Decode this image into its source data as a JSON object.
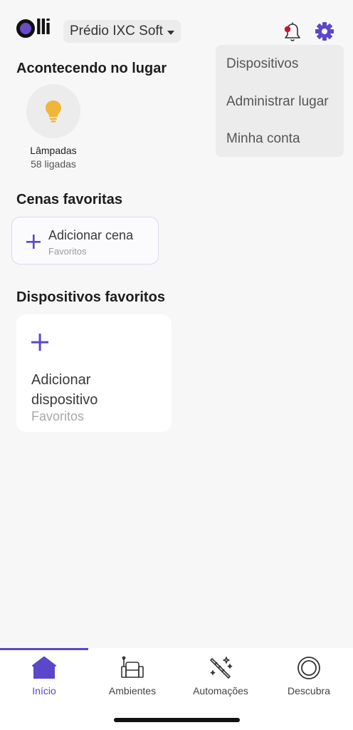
{
  "header": {
    "place_name": "Prédio IXC Soft",
    "brand_color": "#5b47c9",
    "notification_dot_color": "#c5142e"
  },
  "menu": {
    "items": [
      {
        "label": "Dispositivos"
      },
      {
        "label": "Administrar lugar"
      },
      {
        "label": "Minha conta"
      }
    ]
  },
  "happening": {
    "title": "Acontecendo no lugar",
    "lamps": {
      "label": "Lâmpadas",
      "status": "58 ligadas",
      "icon": "lightbulb-icon",
      "icon_color": "#f0b63a"
    }
  },
  "scenes": {
    "title": "Cenas favoritas",
    "add_label": "Adicionar cena",
    "add_sub": "Favoritos"
  },
  "devices": {
    "title": "Dispositivos favoritos",
    "add_label": "Adicionar dispositivo",
    "add_sub": "Favoritos"
  },
  "tabs": [
    {
      "label": "Início",
      "icon": "home-icon",
      "active": true
    },
    {
      "label": "Ambientes",
      "icon": "armchair-icon",
      "active": false
    },
    {
      "label": "Automações",
      "icon": "magic-wand-icon",
      "active": false
    },
    {
      "label": "Descubra",
      "icon": "discover-circle-icon",
      "active": false
    }
  ]
}
